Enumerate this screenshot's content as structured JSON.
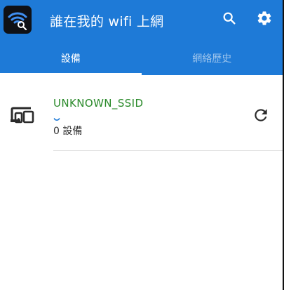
{
  "app": {
    "title": "誰在我的 wifi 上網",
    "accent_color": "#1e7ad7",
    "icon": "wifi-search-icon"
  },
  "toolbar": {
    "search_icon": "search-icon",
    "settings_icon": "gear-icon"
  },
  "tabs": [
    {
      "label": "設備",
      "active": true
    },
    {
      "label": "網絡歷史",
      "active": false
    }
  ],
  "network": {
    "ssid": "UNKNOWN_SSID",
    "ssid_color": "#2a8a2a",
    "device_count": "0 設備",
    "loading": true,
    "device_icon": "devices-icon",
    "refresh_icon": "refresh-icon"
  }
}
